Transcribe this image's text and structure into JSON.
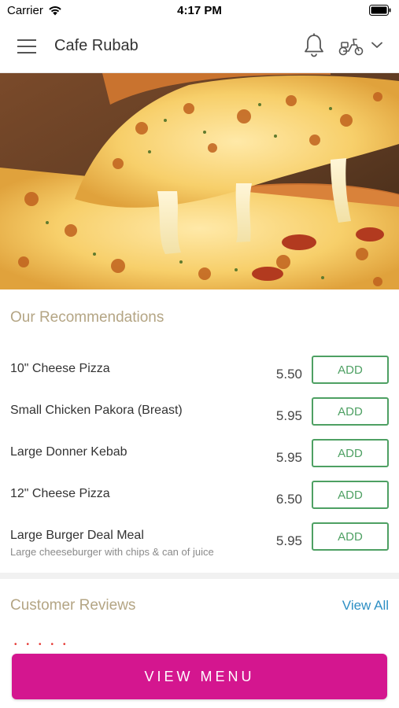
{
  "status_bar": {
    "carrier": "Carrier",
    "time": "4:17 PM"
  },
  "header": {
    "title": "Cafe Rubab",
    "icons": [
      "menu-icon",
      "bell-icon",
      "scooter-icon",
      "chevron-down-icon"
    ]
  },
  "hero": {
    "image": "pizza slice with stretched cheese"
  },
  "recommendations": {
    "title": "Our Recommendations",
    "add_label": "ADD",
    "items": [
      {
        "name": "10\" Cheese Pizza",
        "description": "",
        "price": "5.50"
      },
      {
        "name": "Small Chicken Pakora (Breast)",
        "description": "",
        "price": "5.95"
      },
      {
        "name": "Large Donner Kebab",
        "description": "",
        "price": "5.95"
      },
      {
        "name": "12\" Cheese Pizza",
        "description": "",
        "price": "6.50"
      },
      {
        "name": "Large Burger Deal Meal",
        "description": "Large cheeseburger with chips & can of juice",
        "price": "5.95"
      }
    ]
  },
  "reviews": {
    "title": "Customer Reviews",
    "view_all_label": "View All"
  },
  "footer": {
    "view_menu_label": "VIEW MENU"
  },
  "colors": {
    "accent": "#d4168f",
    "add_green": "#4ea063",
    "section_title": "#b4a584",
    "link_blue": "#2d8fc4"
  }
}
